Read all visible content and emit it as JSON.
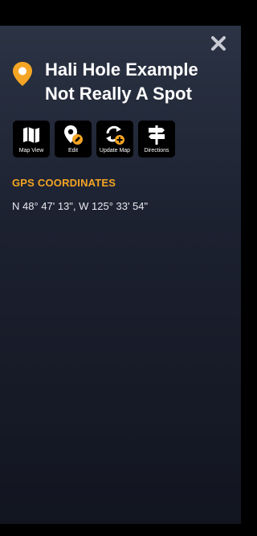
{
  "header": {
    "title_line1": "Hali Hole Example",
    "title_line2": "Not Really A Spot"
  },
  "actions": [
    {
      "label": "Map View",
      "icon": "map-icon"
    },
    {
      "label": "Edit",
      "icon": "edit-pin-icon"
    },
    {
      "label": "Update Map",
      "icon": "refresh-add-icon"
    },
    {
      "label": "Directions",
      "icon": "signpost-icon"
    }
  ],
  "gps": {
    "section_title": "GPS COORDINATES",
    "value": "N 48° 47' 13\", W 125° 33' 54\""
  },
  "colors": {
    "accent": "#f5a524",
    "pin": "#f5a524",
    "close": "#c7cad3",
    "panel_top": "#2b3344",
    "panel_bottom": "#121520"
  }
}
